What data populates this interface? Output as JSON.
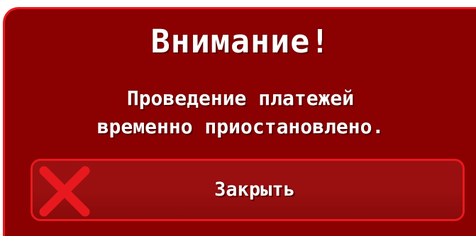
{
  "dialog": {
    "title": "Внимание!",
    "message_lines": [
      "Проведение платежей",
      "временно приостановлено."
    ],
    "close_button": {
      "label": "Закрыть",
      "icon": "close-icon"
    }
  },
  "colors": {
    "dialog_background": "#8b0000",
    "border_accent": "#e8191e",
    "button_background": "#9a1010",
    "text": "#ffffff"
  }
}
